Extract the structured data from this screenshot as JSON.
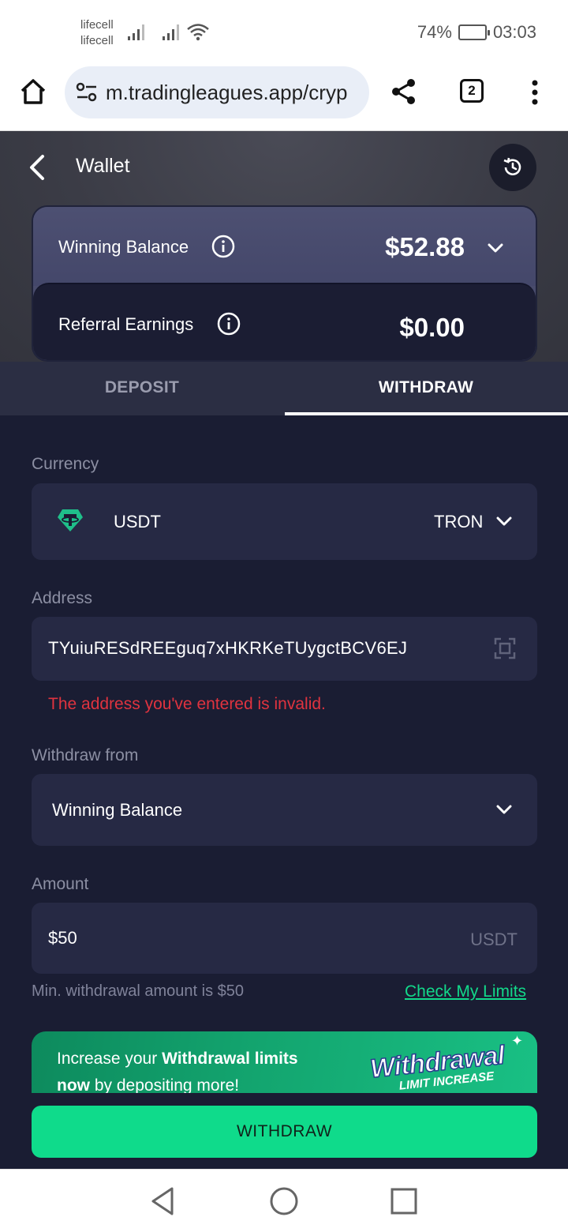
{
  "status_bar": {
    "carrier_1": "lifecell",
    "carrier_2": "lifecell",
    "battery_percent": "74%",
    "battery_level": 0.74,
    "time": "03:03"
  },
  "browser": {
    "url": "m.tradingleagues.app/cryp",
    "tab_count": "2"
  },
  "app": {
    "title": "Wallet",
    "winning_balance_label": "Winning Balance",
    "winning_balance_value": "$52.88",
    "referral_label": "Referral Earnings",
    "referral_value": "$0.00",
    "tabs": [
      {
        "label": "DEPOSIT",
        "active": false
      },
      {
        "label": "WITHDRAW",
        "active": true
      }
    ],
    "currency_label": "Currency",
    "currency_value": "USDT",
    "network_value": "TRON",
    "address_label": "Address",
    "address_value": "TYuiuRESdREEguq7xHKRKeTUygctBCV6EJ",
    "address_error": "The address you've entered is invalid.",
    "withdraw_from_label": "Withdraw from",
    "withdraw_from_value": "Winning Balance",
    "amount_label": "Amount",
    "amount_value": "$50",
    "amount_unit": "USDT",
    "min_hint": "Min. withdrawal amount is $50",
    "limits_link": "Check My Limits",
    "promo": {
      "text_1": "Increase your ",
      "text_bold_1": "Withdrawal limits",
      "text_bold_2": "now",
      "text_2": " by depositing more!",
      "badge_title": "Withdrawal",
      "badge_subtitle": "LIMIT INCREASE"
    },
    "withdraw_button": "WITHDRAW"
  },
  "colors": {
    "accent": "#0fdb8b",
    "error": "#e0333f",
    "app_bg": "#1a1d33"
  }
}
